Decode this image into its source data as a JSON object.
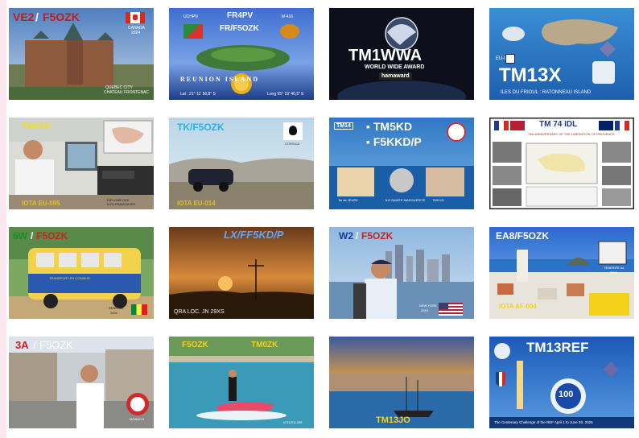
{
  "cards": [
    {
      "call_a": "VE2",
      "sep": "/",
      "call_b": "F5OZK",
      "small_1": "CANADA",
      "small_2": "2024",
      "small_3": "QUEBEC CITY",
      "small_4": "CHATEAU FRONTENAC"
    },
    {
      "call": "FR4PV",
      "call2": "FR/F5OZK",
      "left_small": "UCHPN",
      "right_small": "M 416",
      "title": "REUNION ISLAND",
      "lat": "Lat : 21° 11' 56,8\" S",
      "long": "Long 55° 19' 40,5\" E"
    },
    {
      "call": "TM1WWA",
      "sub": "WORLD WIDE AWARD",
      "brand": "hamaward"
    },
    {
      "iota": "EU-095",
      "call": "TM13X",
      "caption": "ILES DU FRIOUL : RATONNEAU ISLAND"
    },
    {
      "call": "TM0ZK",
      "iota": "IOTA EU-095",
      "small_1": "DIPLOME DES",
      "small_2": "ILES FRANCAISES"
    },
    {
      "call": "TK/F5OZK",
      "iota": "IOTA EU-014",
      "small": "CORSICA"
    },
    {
      "tag": "TM14",
      "call1": "▪ TM5KD",
      "call2": "▪ F5KKD/P",
      "cap1": "Île de JEUPE",
      "cap2": "ILE SAINTE MARGUERITE",
      "cap3": "TM5 KD"
    },
    {
      "call": "TM 74 IDL",
      "sub": "74th ANNIVERSARY OF THE LIBERATION OF PROVENCE"
    },
    {
      "call_a": "6W",
      "sep": "/",
      "call_b": "F5OZK",
      "bus": "TRANSPORT EN COMMUN",
      "small_1": "SENEGAL",
      "small_2": "2004"
    },
    {
      "call": "LX/FF5KD/P",
      "loc": "QRA LOC. JN 29XS"
    },
    {
      "call_a": "W2",
      "sep": "/",
      "call_b": "F5OZK",
      "small_1": "NEW YORK",
      "small_2": "2019"
    },
    {
      "call": "EA8/F5OZK",
      "cap1": "TENERIFE Isl.",
      "cap2": "2023",
      "iota": "IOTA AF-004"
    },
    {
      "call_a": "3A",
      "sep": "/",
      "call_b": "F5OZK",
      "small": "MONACO"
    },
    {
      "call1": "F5OZK",
      "call2": "TM0ZK",
      "small": "IOTA EU-095"
    },
    {
      "call": "TM13JO"
    },
    {
      "call": "TM13REF",
      "badge": "100",
      "caption": "The Centenary Challenge of the REF April 1 to June 30, 2025"
    }
  ]
}
